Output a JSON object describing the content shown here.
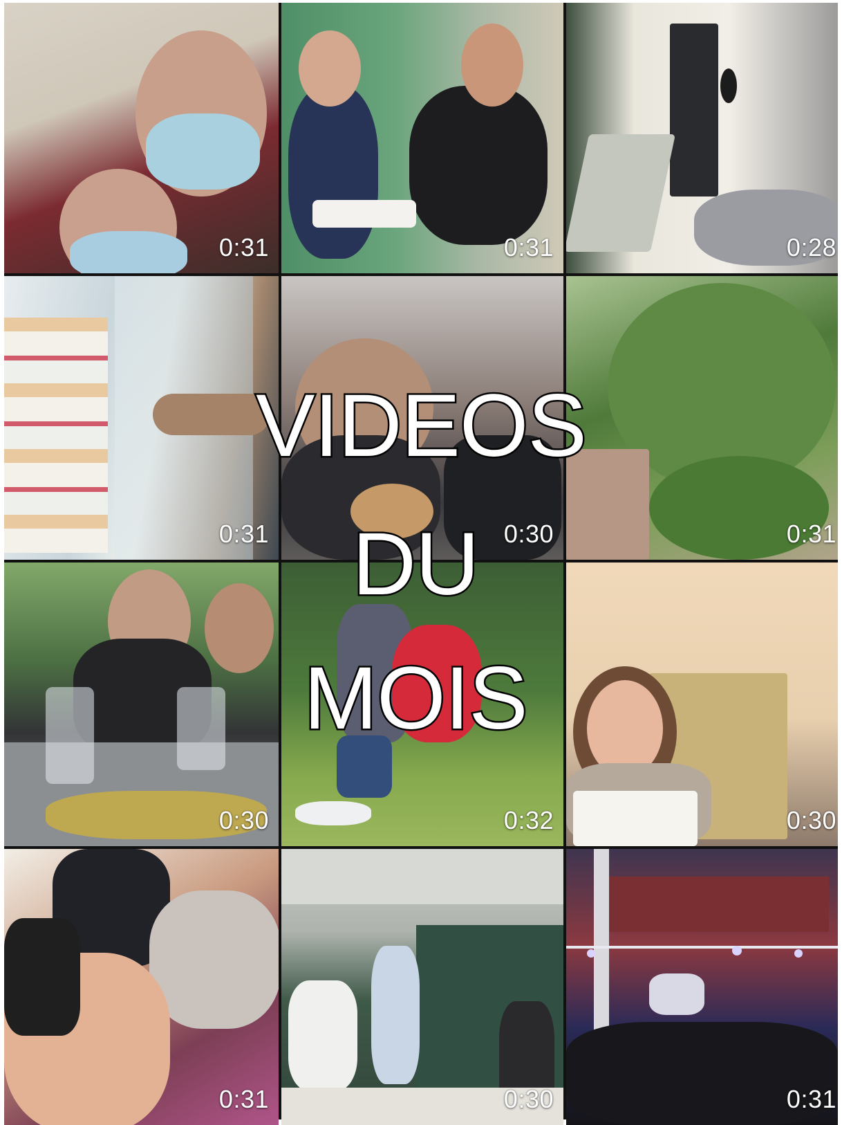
{
  "overlay": {
    "line1": "VIDEOS",
    "line2": "DU",
    "line3": "MOIS"
  },
  "videos": [
    {
      "duration": "0:31"
    },
    {
      "duration": "0:31"
    },
    {
      "duration": "0:28"
    },
    {
      "duration": "0:31"
    },
    {
      "duration": "0:30"
    },
    {
      "duration": "0:31"
    },
    {
      "duration": "0:30"
    },
    {
      "duration": "0:32"
    },
    {
      "duration": "0:30"
    },
    {
      "duration": "0:31"
    },
    {
      "duration": "0:30"
    },
    {
      "duration": "0:31"
    }
  ]
}
